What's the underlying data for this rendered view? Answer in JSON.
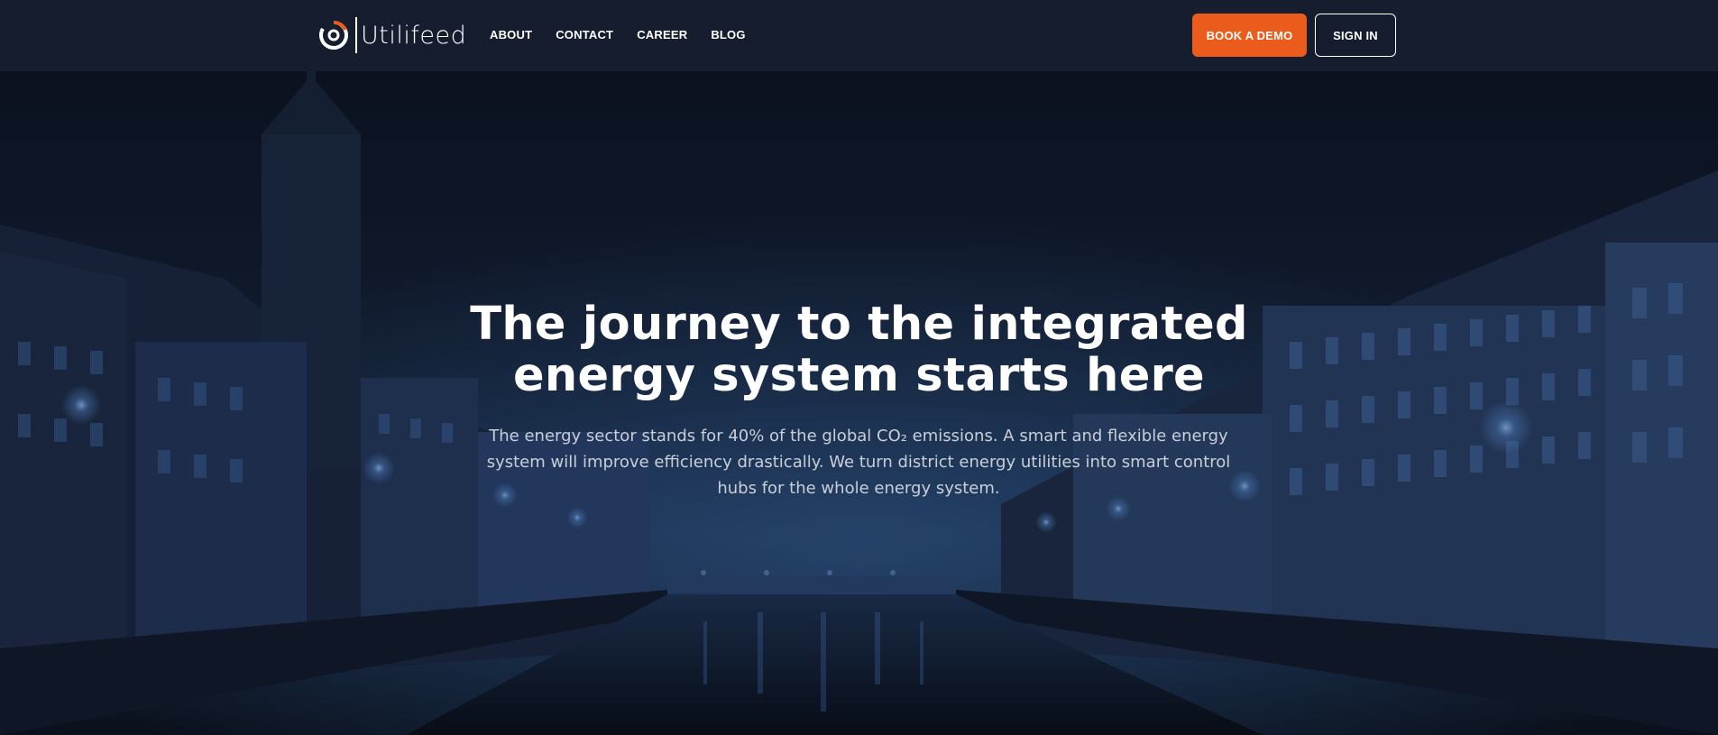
{
  "brand": {
    "name": "Utilifeed",
    "accent_color": "#ea5b1c",
    "logo_icon": "utilifeed-logo-icon"
  },
  "nav": {
    "items": [
      {
        "label": "ABOUT"
      },
      {
        "label": "CONTACT"
      },
      {
        "label": "CAREER"
      },
      {
        "label": "BLOG"
      }
    ]
  },
  "actions": {
    "book_demo_label": "BOOK A DEMO",
    "sign_in_label": "SIGN IN"
  },
  "hero": {
    "title_line1": "The journey to the integrated",
    "title_line2": "energy system starts here",
    "subtitle": "The energy sector stands for 40% of the global CO₂ emissions. A smart and flexible energy system will improve efficiency drastically. We turn district energy utilities into smart control hubs for the whole energy system.",
    "background": "night-city-canal-photo"
  }
}
